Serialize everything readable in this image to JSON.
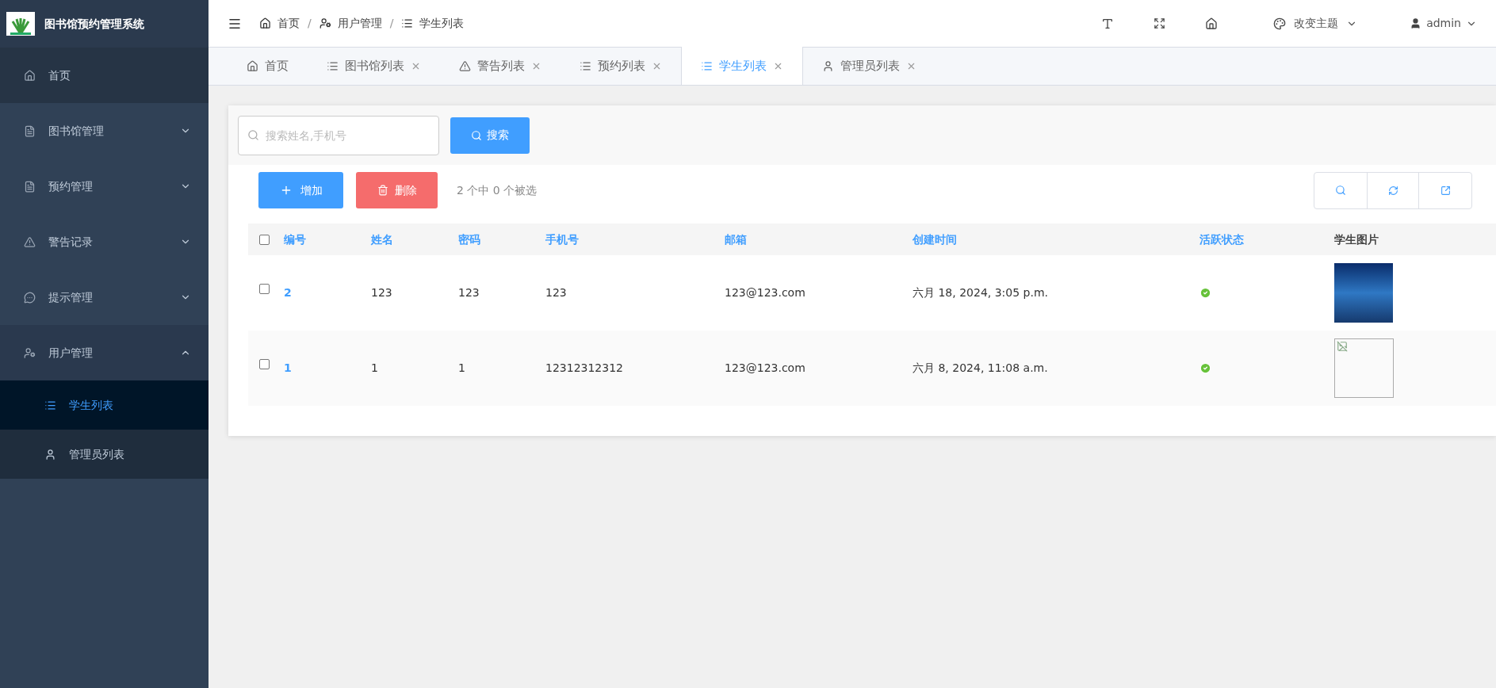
{
  "app": {
    "title": "图书馆预约管理系统"
  },
  "sidebar": {
    "items": [
      {
        "label": "首页",
        "selected": false
      },
      {
        "label": "图书馆管理",
        "expanded": false
      },
      {
        "label": "预约管理",
        "expanded": false
      },
      {
        "label": "警告记录",
        "expanded": false
      },
      {
        "label": "提示管理",
        "expanded": false
      },
      {
        "label": "用户管理",
        "expanded": true,
        "children": [
          {
            "label": "学生列表",
            "selected": true
          },
          {
            "label": "管理员列表",
            "selected": false
          }
        ]
      }
    ]
  },
  "breadcrumb": [
    {
      "label": "首页"
    },
    {
      "separator": "/",
      "label": "用户管理"
    },
    {
      "separator": "/",
      "label": "学生列表"
    }
  ],
  "header": {
    "theme_menu": "改变主题",
    "user": "admin"
  },
  "tabs": [
    {
      "label": "首页",
      "selected": false,
      "closable": false
    },
    {
      "label": "图书馆列表",
      "selected": false,
      "closable": true
    },
    {
      "label": "警告列表",
      "selected": false,
      "closable": true
    },
    {
      "label": "预约列表",
      "selected": false,
      "closable": true
    },
    {
      "label": "学生列表",
      "selected": true,
      "closable": true
    },
    {
      "label": "管理员列表",
      "selected": false,
      "closable": true
    }
  ],
  "search": {
    "placeholder": "搜索姓名,手机号",
    "button": "搜索"
  },
  "toolbar": {
    "add": "增加",
    "delete": "删除",
    "selection": "2 个中 0 个被选"
  },
  "table": {
    "all_checked": false,
    "columns": [
      {
        "label": "编号",
        "sortable": true
      },
      {
        "label": "姓名",
        "sortable": true
      },
      {
        "label": "密码",
        "sortable": true
      },
      {
        "label": "手机号",
        "sortable": true
      },
      {
        "label": "邮箱",
        "sortable": true
      },
      {
        "label": "创建时间",
        "sortable": true
      },
      {
        "label": "活跃状态",
        "sortable": true
      },
      {
        "label": "学生图片",
        "sortable": false
      }
    ],
    "rows": [
      {
        "checked": false,
        "id": "2",
        "name": "123",
        "password": "123",
        "phone": "123",
        "email": "123@123.com",
        "created": "六月 18, 2024, 3:05 p.m.",
        "active": true,
        "kind": "photo"
      },
      {
        "checked": false,
        "id": "1",
        "name": "1",
        "password": "1",
        "phone": "12312312312",
        "email": "123@123.com",
        "created": "六月 8, 2024, 11:08 a.m.",
        "active": true,
        "kind": "broken"
      }
    ]
  }
}
